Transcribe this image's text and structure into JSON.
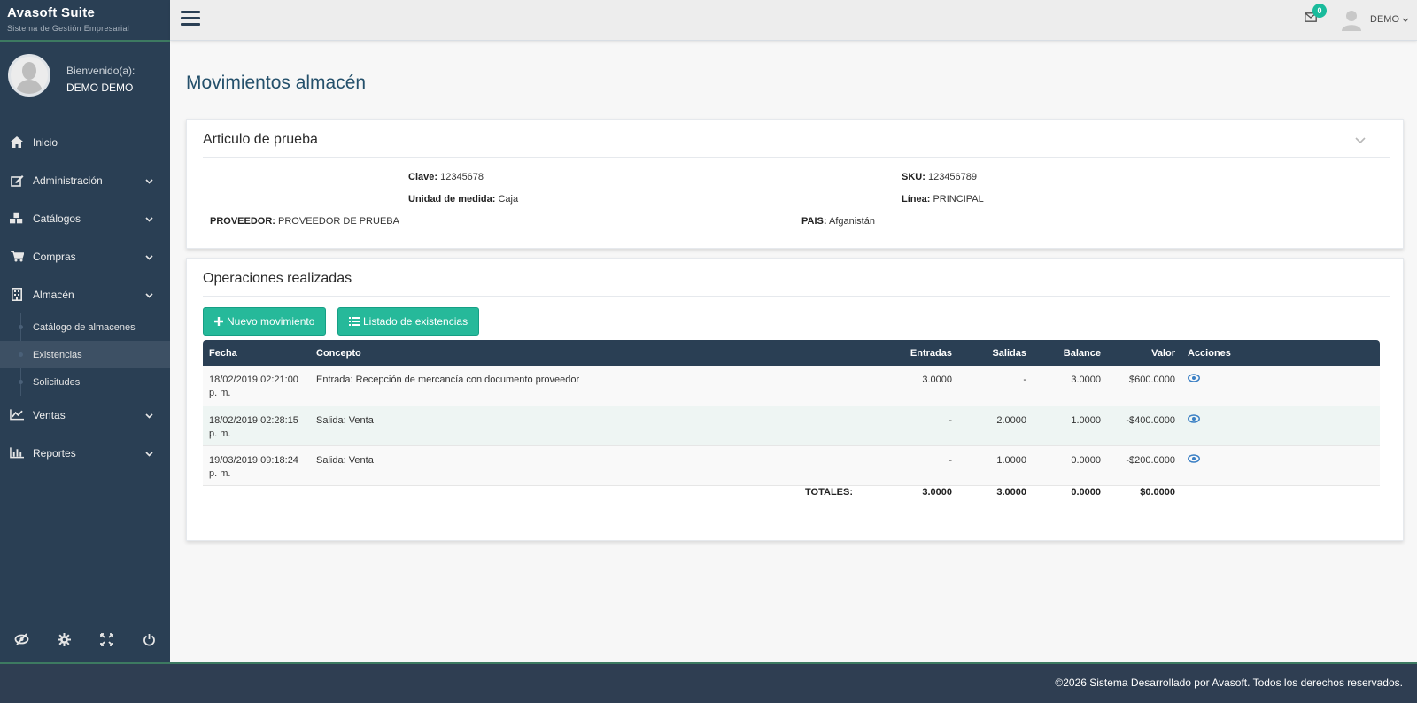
{
  "brand": {
    "title": "Avasoft Suite",
    "subtitle": "Sistema de Gestión Empresarial"
  },
  "profile": {
    "welcome": "Bienvenido(a):",
    "name": "DEMO DEMO"
  },
  "menu": {
    "inicio": "Inicio",
    "administracion": "Administración",
    "catalogos": "Catálogos",
    "compras": "Compras",
    "almacen": "Almacén",
    "sub": [
      "Catálogo de almacenes",
      "Existencias",
      "Solicitudes"
    ],
    "ventas": "Ventas",
    "reportes": "Reportes"
  },
  "topbar": {
    "mail_count": "0",
    "user": "DEMO"
  },
  "page": {
    "title": "Movimientos almacén"
  },
  "article": {
    "title": "Articulo de prueba",
    "clave_label": "Clave:",
    "clave": "12345678",
    "sku_label": "SKU:",
    "sku": "123456789",
    "unidad_label": "Unidad de medida:",
    "unidad": "Caja",
    "linea_label": "Línea:",
    "linea": "PRINCIPAL",
    "proveedor_label": "PROVEEDOR:",
    "proveedor": "PROVEEDOR DE PRUEBA",
    "pais_label": "PAIS:",
    "pais": "Afganistán"
  },
  "operations": {
    "title": "Operaciones realizadas",
    "btn_new": "Nuevo movimiento",
    "btn_list": "Listado de existencias",
    "headers": [
      "Fecha",
      "Concepto",
      "Entradas",
      "Salidas",
      "Balance",
      "Valor",
      "Acciones"
    ],
    "rows": [
      {
        "fecha": "18/02/2019 02:21:00",
        "fecha2": "p. m.",
        "concepto": "Entrada: Recepción de mercancía con documento proveedor",
        "entradas": "3.0000",
        "salidas": "-",
        "balance": "3.0000",
        "valor": "$600.0000"
      },
      {
        "fecha": "18/02/2019 02:28:15",
        "fecha2": "p. m.",
        "concepto": "Salida: Venta",
        "entradas": "-",
        "salidas": "2.0000",
        "balance": "1.0000",
        "valor": "-$400.0000"
      },
      {
        "fecha": "19/03/2019 09:18:24",
        "fecha2": "p. m.",
        "concepto": "Salida: Venta",
        "entradas": "-",
        "salidas": "1.0000",
        "balance": "0.0000",
        "valor": "-$200.0000"
      }
    ],
    "totals": {
      "label": "TOTALES:",
      "entradas": "3.0000",
      "salidas": "3.0000",
      "balance": "0.0000",
      "valor": "$0.0000"
    }
  },
  "footer": {
    "text": "©2026 Sistema Desarrollado por Avasoft. Todos los derechos reservados."
  },
  "colors": {
    "sidebar": "#2a3f54",
    "accent": "#26b99a",
    "title": "#24506b"
  }
}
